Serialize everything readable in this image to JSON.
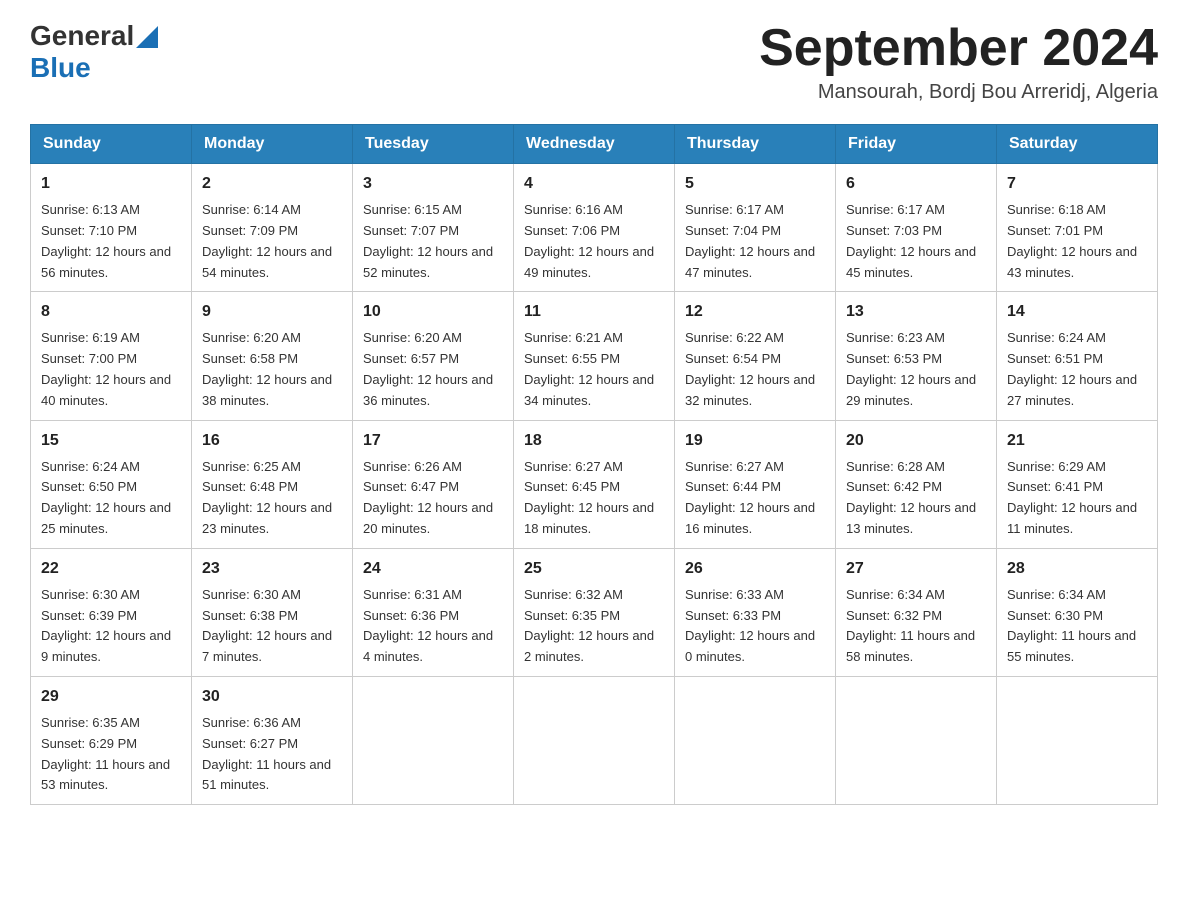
{
  "header": {
    "logo_general": "General",
    "logo_blue": "Blue",
    "month_title": "September 2024",
    "location": "Mansourah, Bordj Bou Arreridj, Algeria"
  },
  "weekdays": [
    "Sunday",
    "Monday",
    "Tuesday",
    "Wednesday",
    "Thursday",
    "Friday",
    "Saturday"
  ],
  "weeks": [
    [
      {
        "day": "1",
        "sunrise": "6:13 AM",
        "sunset": "7:10 PM",
        "daylight": "12 hours and 56 minutes."
      },
      {
        "day": "2",
        "sunrise": "6:14 AM",
        "sunset": "7:09 PM",
        "daylight": "12 hours and 54 minutes."
      },
      {
        "day": "3",
        "sunrise": "6:15 AM",
        "sunset": "7:07 PM",
        "daylight": "12 hours and 52 minutes."
      },
      {
        "day": "4",
        "sunrise": "6:16 AM",
        "sunset": "7:06 PM",
        "daylight": "12 hours and 49 minutes."
      },
      {
        "day": "5",
        "sunrise": "6:17 AM",
        "sunset": "7:04 PM",
        "daylight": "12 hours and 47 minutes."
      },
      {
        "day": "6",
        "sunrise": "6:17 AM",
        "sunset": "7:03 PM",
        "daylight": "12 hours and 45 minutes."
      },
      {
        "day": "7",
        "sunrise": "6:18 AM",
        "sunset": "7:01 PM",
        "daylight": "12 hours and 43 minutes."
      }
    ],
    [
      {
        "day": "8",
        "sunrise": "6:19 AM",
        "sunset": "7:00 PM",
        "daylight": "12 hours and 40 minutes."
      },
      {
        "day": "9",
        "sunrise": "6:20 AM",
        "sunset": "6:58 PM",
        "daylight": "12 hours and 38 minutes."
      },
      {
        "day": "10",
        "sunrise": "6:20 AM",
        "sunset": "6:57 PM",
        "daylight": "12 hours and 36 minutes."
      },
      {
        "day": "11",
        "sunrise": "6:21 AM",
        "sunset": "6:55 PM",
        "daylight": "12 hours and 34 minutes."
      },
      {
        "day": "12",
        "sunrise": "6:22 AM",
        "sunset": "6:54 PM",
        "daylight": "12 hours and 32 minutes."
      },
      {
        "day": "13",
        "sunrise": "6:23 AM",
        "sunset": "6:53 PM",
        "daylight": "12 hours and 29 minutes."
      },
      {
        "day": "14",
        "sunrise": "6:24 AM",
        "sunset": "6:51 PM",
        "daylight": "12 hours and 27 minutes."
      }
    ],
    [
      {
        "day": "15",
        "sunrise": "6:24 AM",
        "sunset": "6:50 PM",
        "daylight": "12 hours and 25 minutes."
      },
      {
        "day": "16",
        "sunrise": "6:25 AM",
        "sunset": "6:48 PM",
        "daylight": "12 hours and 23 minutes."
      },
      {
        "day": "17",
        "sunrise": "6:26 AM",
        "sunset": "6:47 PM",
        "daylight": "12 hours and 20 minutes."
      },
      {
        "day": "18",
        "sunrise": "6:27 AM",
        "sunset": "6:45 PM",
        "daylight": "12 hours and 18 minutes."
      },
      {
        "day": "19",
        "sunrise": "6:27 AM",
        "sunset": "6:44 PM",
        "daylight": "12 hours and 16 minutes."
      },
      {
        "day": "20",
        "sunrise": "6:28 AM",
        "sunset": "6:42 PM",
        "daylight": "12 hours and 13 minutes."
      },
      {
        "day": "21",
        "sunrise": "6:29 AM",
        "sunset": "6:41 PM",
        "daylight": "12 hours and 11 minutes."
      }
    ],
    [
      {
        "day": "22",
        "sunrise": "6:30 AM",
        "sunset": "6:39 PM",
        "daylight": "12 hours and 9 minutes."
      },
      {
        "day": "23",
        "sunrise": "6:30 AM",
        "sunset": "6:38 PM",
        "daylight": "12 hours and 7 minutes."
      },
      {
        "day": "24",
        "sunrise": "6:31 AM",
        "sunset": "6:36 PM",
        "daylight": "12 hours and 4 minutes."
      },
      {
        "day": "25",
        "sunrise": "6:32 AM",
        "sunset": "6:35 PM",
        "daylight": "12 hours and 2 minutes."
      },
      {
        "day": "26",
        "sunrise": "6:33 AM",
        "sunset": "6:33 PM",
        "daylight": "12 hours and 0 minutes."
      },
      {
        "day": "27",
        "sunrise": "6:34 AM",
        "sunset": "6:32 PM",
        "daylight": "11 hours and 58 minutes."
      },
      {
        "day": "28",
        "sunrise": "6:34 AM",
        "sunset": "6:30 PM",
        "daylight": "11 hours and 55 minutes."
      }
    ],
    [
      {
        "day": "29",
        "sunrise": "6:35 AM",
        "sunset": "6:29 PM",
        "daylight": "11 hours and 53 minutes."
      },
      {
        "day": "30",
        "sunrise": "6:36 AM",
        "sunset": "6:27 PM",
        "daylight": "11 hours and 51 minutes."
      },
      null,
      null,
      null,
      null,
      null
    ]
  ]
}
